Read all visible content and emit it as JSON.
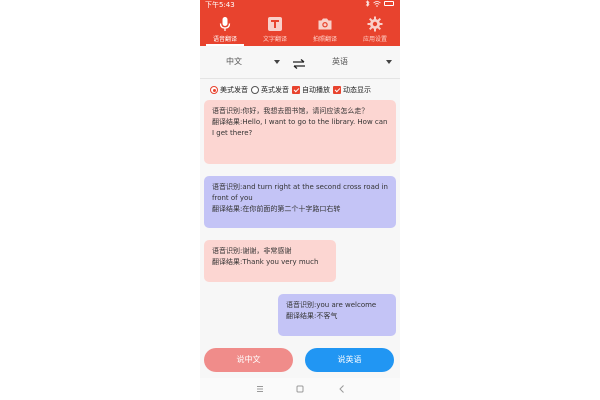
{
  "status": {
    "time": "下午5:43"
  },
  "tabs": [
    {
      "label": "语音翻译",
      "icon": "microphone-icon",
      "active": true
    },
    {
      "label": "文字翻译",
      "icon": "text-icon",
      "active": false
    },
    {
      "label": "拍照翻译",
      "icon": "camera-icon",
      "active": false
    },
    {
      "label": "应用设置",
      "icon": "gear-icon",
      "active": false
    }
  ],
  "languages": {
    "source": "中文",
    "target": "英语",
    "swap_icon": "swap-arrows-icon"
  },
  "options": {
    "us_pronunciation": "美式发音",
    "uk_pronunciation": "英式发音",
    "auto_play": "自动播放",
    "auto_display": "动态显示",
    "selected_pronunciation": "us",
    "auto_play_checked": true,
    "auto_display_checked": true
  },
  "messages": [
    {
      "side": "left",
      "color": "pink",
      "recognition": "语音识别:你好，我想去图书馆，请问应该怎么走？",
      "translation": "翻译结果:Hello, I want to go to the library. How can I get there?"
    },
    {
      "side": "full",
      "color": "blue",
      "recognition": "语音识别:and turn right at the second cross road in front of you",
      "translation": "翻译结果:在你前面的第二个十字路口右转"
    },
    {
      "side": "left",
      "color": "pink",
      "recognition": "语音识别:谢谢，非常感谢",
      "translation": "翻译结果:Thank you very much"
    },
    {
      "side": "right",
      "color": "blue",
      "recognition": "语音识别:you are welcome",
      "translation": "翻译结果:不客气"
    }
  ],
  "buttons": {
    "speak_chinese": "说中文",
    "speak_english": "说英语"
  },
  "colors": {
    "brand": "#e8432e",
    "pink_bubble": "#fcd6d2",
    "blue_bubble": "#c4c4f6",
    "english_button": "#2196f3",
    "chinese_button": "#f08c8a"
  },
  "navbar": {
    "icons": [
      "menu-icon",
      "home-icon",
      "back-icon"
    ]
  }
}
